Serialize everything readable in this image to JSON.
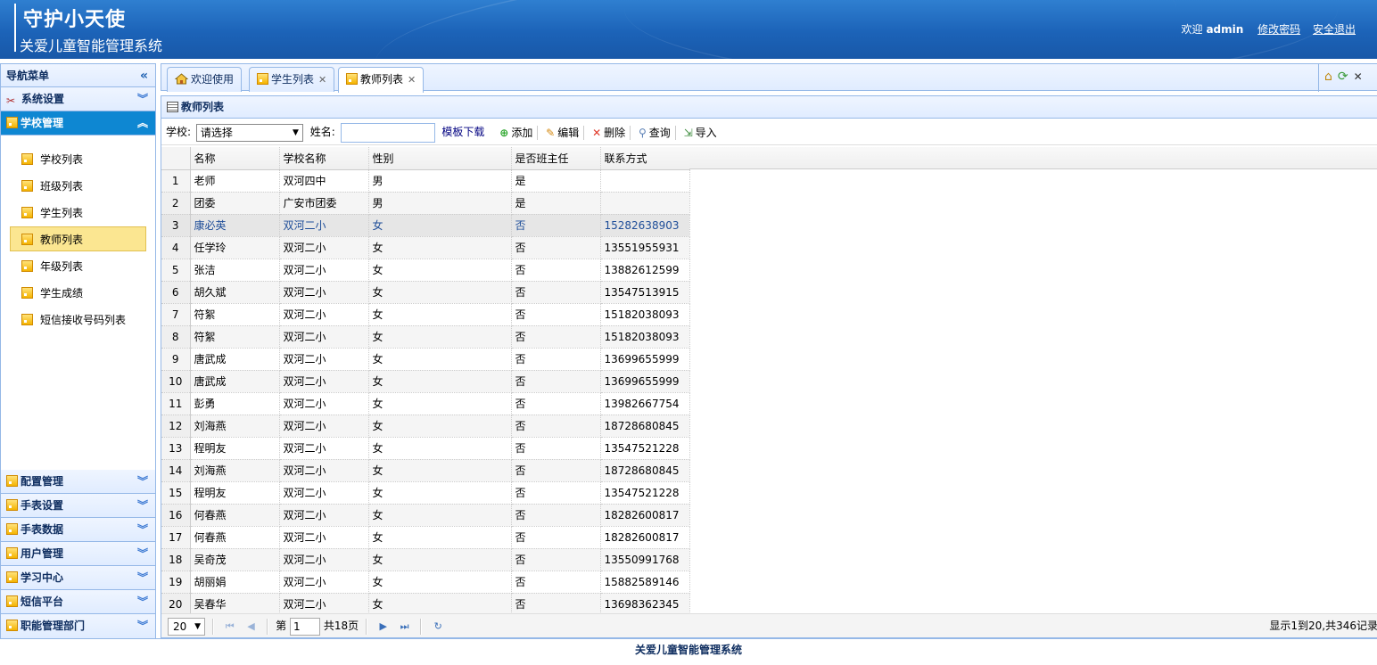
{
  "header": {
    "title": "守护小天使",
    "subtitle": "关爱儿童智能管理系统",
    "welcome": "欢迎",
    "username": "admin",
    "change_password": "修改密码",
    "logout": "安全退出"
  },
  "sidebar": {
    "title": "导航菜单",
    "sections": [
      {
        "label": "系统设置"
      },
      {
        "label": "学校管理"
      },
      {
        "label": "配置管理"
      },
      {
        "label": "手表设置"
      },
      {
        "label": "手表数据"
      },
      {
        "label": "用户管理"
      },
      {
        "label": "学习中心"
      },
      {
        "label": "短信平台"
      },
      {
        "label": "职能管理部门"
      }
    ],
    "items": [
      {
        "label": "学校列表"
      },
      {
        "label": "班级列表"
      },
      {
        "label": "学生列表"
      },
      {
        "label": "教师列表"
      },
      {
        "label": "年级列表"
      },
      {
        "label": "学生成绩"
      },
      {
        "label": "短信接收号码列表"
      }
    ]
  },
  "tabs": [
    {
      "label": "欢迎使用"
    },
    {
      "label": "学生列表"
    },
    {
      "label": "教师列表"
    }
  ],
  "panel": {
    "title": "教师列表"
  },
  "toolbar": {
    "school_label": "学校:",
    "school_value": "请选择",
    "name_label": "姓名:",
    "name_value": "",
    "template_link": "模板下载",
    "add": "添加",
    "edit": "编辑",
    "delete": "删除",
    "query": "查询",
    "import": "导入"
  },
  "table": {
    "headers": [
      "名称",
      "学校名称",
      "性别",
      "是否班主任",
      "联系方式"
    ],
    "rows": [
      [
        "1",
        "老师",
        "双河四中",
        "男",
        "是",
        ""
      ],
      [
        "2",
        "团委",
        "广安市团委",
        "男",
        "是",
        ""
      ],
      [
        "3",
        "康必英",
        "双河二小",
        "女",
        "否",
        "15282638903"
      ],
      [
        "4",
        "任学玲",
        "双河二小",
        "女",
        "否",
        "13551955931"
      ],
      [
        "5",
        "张洁",
        "双河二小",
        "女",
        "否",
        "13882612599"
      ],
      [
        "6",
        "胡久斌",
        "双河二小",
        "女",
        "否",
        "13547513915"
      ],
      [
        "7",
        "符絮",
        "双河二小",
        "女",
        "否",
        "15182038093"
      ],
      [
        "8",
        "符絮",
        "双河二小",
        "女",
        "否",
        "15182038093"
      ],
      [
        "9",
        "唐武成",
        "双河二小",
        "女",
        "否",
        "13699655999"
      ],
      [
        "10",
        "唐武成",
        "双河二小",
        "女",
        "否",
        "13699655999"
      ],
      [
        "11",
        "彭勇",
        "双河二小",
        "女",
        "否",
        "13982667754"
      ],
      [
        "12",
        "刘海燕",
        "双河二小",
        "女",
        "否",
        "18728680845"
      ],
      [
        "13",
        "程明友",
        "双河二小",
        "女",
        "否",
        "13547521228"
      ],
      [
        "14",
        "刘海燕",
        "双河二小",
        "女",
        "否",
        "18728680845"
      ],
      [
        "15",
        "程明友",
        "双河二小",
        "女",
        "否",
        "13547521228"
      ],
      [
        "16",
        "何春燕",
        "双河二小",
        "女",
        "否",
        "18282600817"
      ],
      [
        "17",
        "何春燕",
        "双河二小",
        "女",
        "否",
        "18282600817"
      ],
      [
        "18",
        "吴奇茂",
        "双河二小",
        "女",
        "否",
        "13550991768"
      ],
      [
        "19",
        "胡丽娟",
        "双河二小",
        "女",
        "否",
        "15882589146"
      ],
      [
        "20",
        "吴春华",
        "双河二小",
        "女",
        "否",
        "13698362345"
      ]
    ]
  },
  "pager": {
    "page_size": "20",
    "page_prefix": "第",
    "page_value": "1",
    "page_total": "共18页",
    "info": "显示1到20,共346记录"
  },
  "footer": {
    "text": "关爱儿童智能管理系统"
  }
}
